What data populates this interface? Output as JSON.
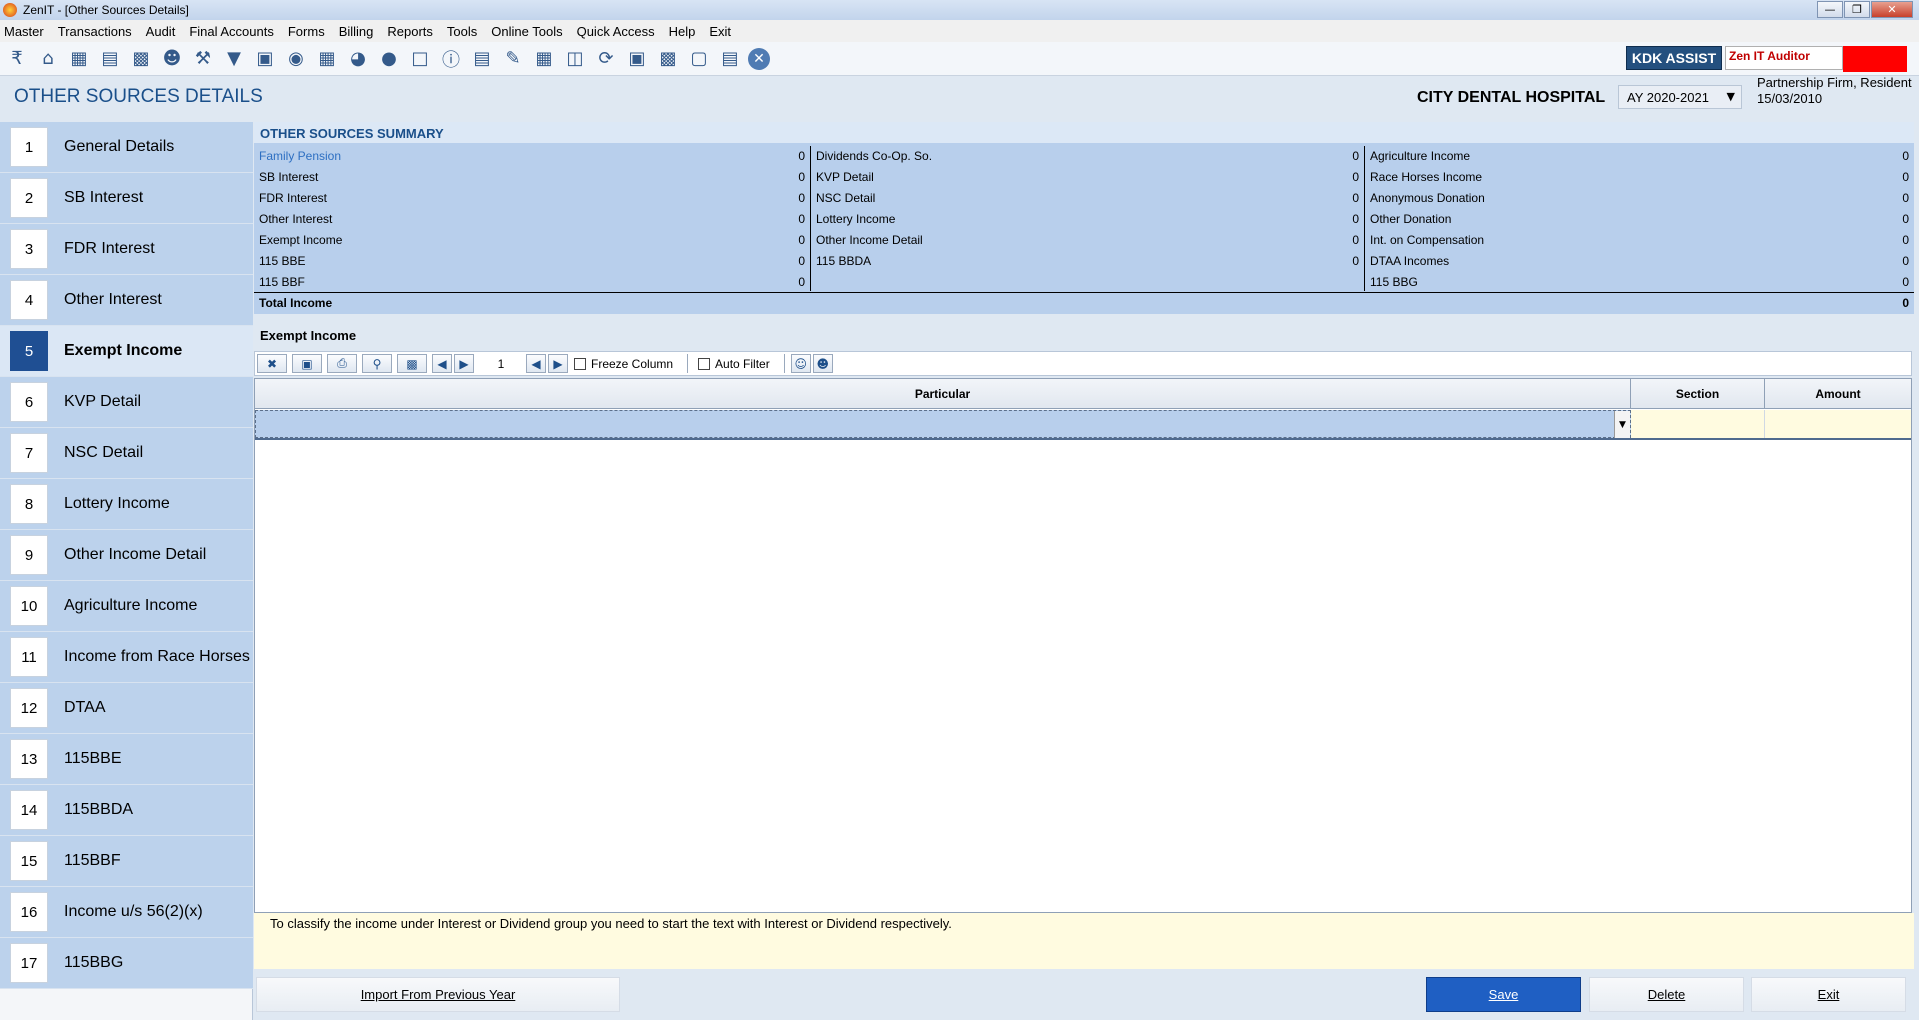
{
  "window": {
    "title": "ZenIT - [Other Sources Details]"
  },
  "menu": [
    "Master",
    "Transactions",
    "Audit",
    "Final Accounts",
    "Forms",
    "Billing",
    "Reports",
    "Tools",
    "Online Tools",
    "Quick Access",
    "Help",
    "Exit"
  ],
  "toolbar": {
    "icons": [
      "rupee-doc-icon",
      "home-icon",
      "building-icon",
      "bar-chart-icon",
      "gift-icon",
      "users-icon",
      "hammer-icon",
      "funnel-icon",
      "tax-icon",
      "coin-icon",
      "calculator-icon",
      "pie-chart-icon",
      "pay-icon",
      "book-icon",
      "info-icon",
      "report-icon",
      "edit-doc-icon",
      "calendar-icon",
      "folder-sync-icon",
      "refresh-doc-icon",
      "bs-icon",
      "bs-stack-icon",
      "3cd-icon",
      "form-doc-icon",
      "close-icon"
    ],
    "kdk_assist": "KDK ASSIST",
    "zen_auditor": "Zen IT Auditor"
  },
  "header": {
    "page_title": "OTHER SOURCES DETAILS",
    "client_name": "CITY DENTAL HOSPITAL",
    "assessment_year": "AY 2020-2021",
    "entity_type": "Partnership Firm, Resident",
    "entity_date": "15/03/2010"
  },
  "nav": [
    {
      "num": "1",
      "label": "General Details"
    },
    {
      "num": "2",
      "label": "SB Interest"
    },
    {
      "num": "3",
      "label": "FDR Interest"
    },
    {
      "num": "4",
      "label": "Other Interest"
    },
    {
      "num": "5",
      "label": "Exempt Income"
    },
    {
      "num": "6",
      "label": "KVP Detail"
    },
    {
      "num": "7",
      "label": "NSC Detail"
    },
    {
      "num": "8",
      "label": "Lottery Income"
    },
    {
      "num": "9",
      "label": "Other Income Detail"
    },
    {
      "num": "10",
      "label": "Agriculture Income"
    },
    {
      "num": "11",
      "label": "Income from Race Horses"
    },
    {
      "num": "12",
      "label": "DTAA"
    },
    {
      "num": "13",
      "label": "115BBE"
    },
    {
      "num": "14",
      "label": "115BBDA"
    },
    {
      "num": "15",
      "label": "115BBF"
    },
    {
      "num": "16",
      "label": "Income u/s 56(2)(x)"
    },
    {
      "num": "17",
      "label": "115BBG"
    }
  ],
  "summary": {
    "heading": "OTHER SOURCES SUMMARY",
    "col1": [
      {
        "label": "Family Pension",
        "value": "0"
      },
      {
        "label": "SB Interest",
        "value": "0"
      },
      {
        "label": "FDR Interest",
        "value": "0"
      },
      {
        "label": "Other Interest",
        "value": "0"
      },
      {
        "label": "Exempt Income",
        "value": "0"
      },
      {
        "label": "115 BBE",
        "value": "0"
      },
      {
        "label": "115 BBF",
        "value": "0"
      }
    ],
    "col2": [
      {
        "label": "Dividends Co-Op. So.",
        "value": "0"
      },
      {
        "label": "KVP Detail",
        "value": "0"
      },
      {
        "label": "NSC Detail",
        "value": "0"
      },
      {
        "label": "Lottery Income",
        "value": "0"
      },
      {
        "label": "Other Income Detail",
        "value": "0"
      },
      {
        "label": "115 BBDA",
        "value": "0"
      }
    ],
    "col3": [
      {
        "label": "Agriculture Income",
        "value": "0"
      },
      {
        "label": "Race Horses Income",
        "value": "0"
      },
      {
        "label": "Anonymous Donation",
        "value": "0"
      },
      {
        "label": "Other Donation",
        "value": "0"
      },
      {
        "label": "Int. on Compensation",
        "value": "0"
      },
      {
        "label": "DTAA Incomes",
        "value": "0"
      },
      {
        "label": "115 BBG",
        "value": "0"
      }
    ],
    "total_label": "Total Income",
    "total_value": "0"
  },
  "exempt": {
    "section_title": "Exempt Income",
    "page_number": "1",
    "freeze_column": "Freeze Column",
    "auto_filter": "Auto Filter",
    "columns": [
      "Particular",
      "Section",
      "Amount"
    ],
    "note": "To classify the income under Interest or Dividend group you need to start the text with Interest or Dividend respectively."
  },
  "buttons": {
    "import": "Import From Previous Year",
    "save": "Save",
    "delete": "Delete",
    "exit": "Exit"
  }
}
